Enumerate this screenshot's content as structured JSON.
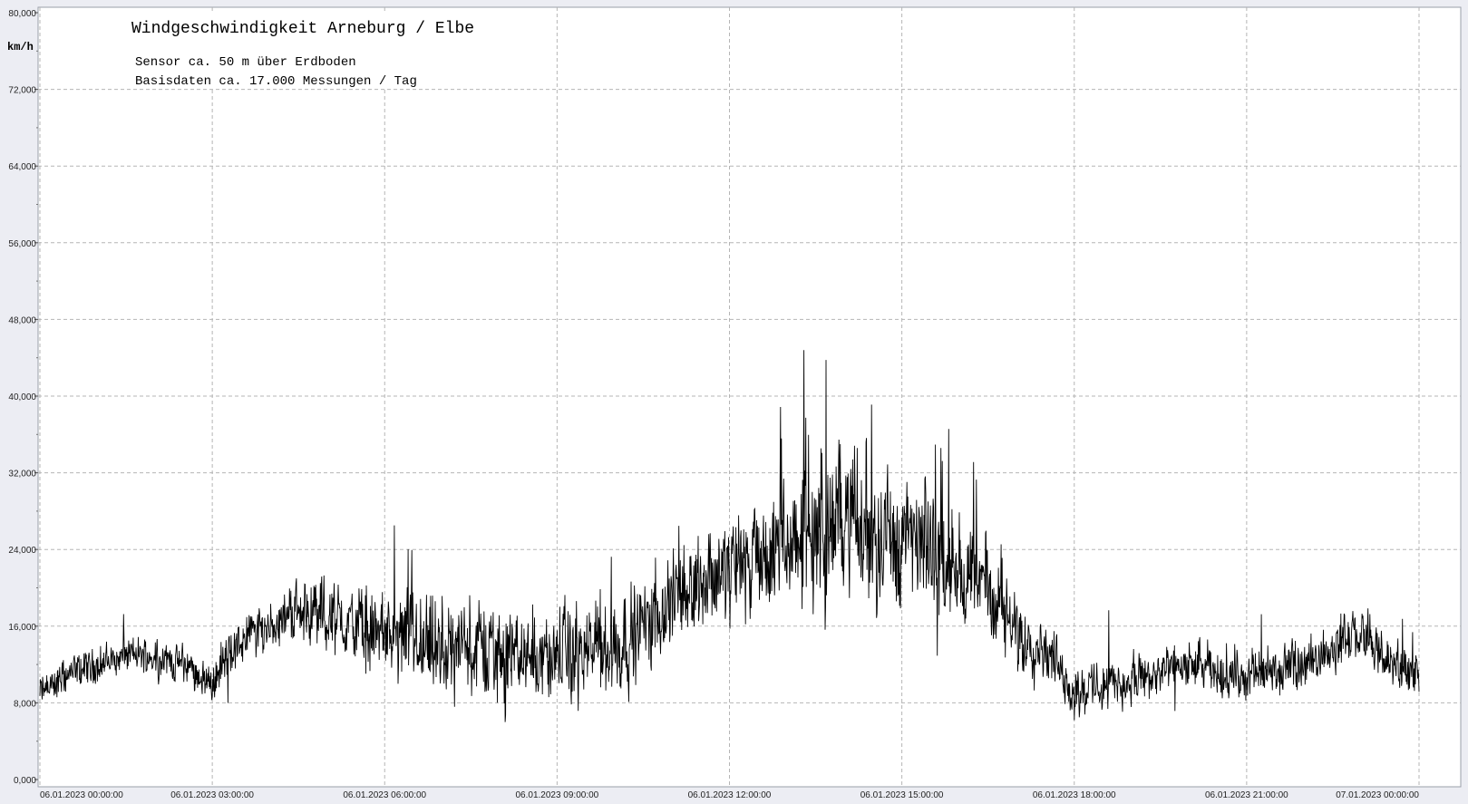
{
  "chart_data": {
    "type": "line",
    "title": "Windgeschwindigkeit  Arneburg / Elbe",
    "subtitles": [
      "Sensor ca. 50 m über Erdboden",
      "Basisdaten ca. 17.000 Messungen / Tag"
    ],
    "ylabel": "km/h",
    "xlabel": "",
    "ylim": [
      0,
      80
    ],
    "yticks": [
      "0,000",
      "8,000",
      "16,000",
      "24,000",
      "32,000",
      "40,000",
      "48,000",
      "56,000",
      "64,000",
      "72,000",
      "80,000"
    ],
    "xlim": [
      0,
      24
    ],
    "xticks": [
      "06.01.2023  00:00:00",
      "06.01.2023  03:00:00",
      "06.01.2023  06:00:00",
      "06.01.2023  09:00:00",
      "06.01.2023  12:00:00",
      "06.01.2023  15:00:00",
      "06.01.2023  18:00:00",
      "06.01.2023  21:00:00",
      "07.01.2023  00:00:00"
    ],
    "grid": true,
    "series": [
      {
        "color": "#000000",
        "x": [
          0,
          0.5,
          1,
          1.5,
          2,
          2.5,
          3,
          3.3,
          3.6,
          4,
          4.5,
          5,
          5.5,
          6,
          6.5,
          7,
          7.5,
          8,
          8.5,
          9,
          9.5,
          10,
          10.5,
          11,
          11.5,
          12,
          12.5,
          13,
          13.5,
          14,
          14.5,
          15,
          15.5,
          16,
          16.5,
          17,
          17.5,
          18,
          18.5,
          19,
          19.5,
          20,
          20.5,
          21,
          21.5,
          22,
          22.5,
          23,
          23.5,
          24
        ],
        "mean": [
          9,
          11,
          12,
          13,
          13,
          12,
          10,
          13,
          15,
          16,
          18,
          17,
          16,
          15,
          14,
          13,
          14,
          13,
          13,
          13,
          13,
          14,
          16,
          19,
          21,
          22,
          23,
          24,
          26,
          27,
          26,
          25,
          24,
          22,
          20,
          15,
          14,
          9,
          10,
          10,
          11,
          12,
          11,
          11,
          11,
          12,
          14,
          15,
          12,
          11
        ],
        "spread": [
          3,
          3,
          3,
          3,
          3,
          3,
          3,
          4,
          4,
          4,
          5,
          6,
          6,
          7,
          8,
          8,
          8,
          8,
          8,
          8,
          8,
          8,
          7,
          8,
          8,
          9,
          9,
          11,
          13,
          13,
          12,
          12,
          10,
          8,
          7,
          6,
          5,
          4,
          4,
          4,
          4,
          4,
          4,
          4,
          4,
          4,
          4,
          4,
          4,
          4
        ]
      }
    ]
  }
}
